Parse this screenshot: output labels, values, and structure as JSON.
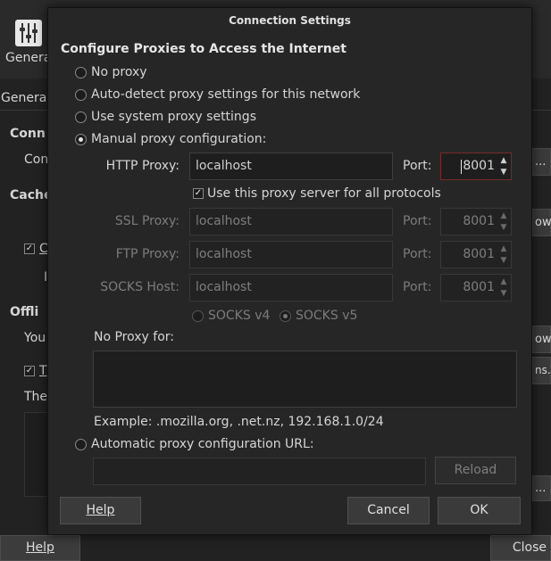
{
  "background_window": {
    "toolbar_tab_label": "Genera",
    "subtab_label": "General",
    "section_connection": "Conn",
    "connection_text": "Con",
    "section_cache": "Cache",
    "cache_check_label": "C",
    "cache_sub": "I",
    "section_offline": "Offli",
    "offline_text": "You",
    "offline_check_label": "T",
    "offline_text2": "The",
    "right_btn_settings": "...",
    "right_btn_now1": "ow",
    "right_btn_now2": "ow",
    "right_btn_ns": "ns...",
    "right_btn_dots": "...",
    "help_button": "Help",
    "close_button": "Close"
  },
  "dialog": {
    "title": "Connection Settings",
    "heading": "Configure Proxies to Access the Internet",
    "options": {
      "no_proxy": "No proxy",
      "auto_detect": "Auto-detect proxy settings for this network",
      "system": "Use system proxy settings",
      "manual": "Manual proxy configuration:",
      "auto_url": "Automatic proxy configuration URL:"
    },
    "http": {
      "label": "HTTP Proxy:",
      "value": "localhost",
      "port_label": "Port:",
      "port": "8001"
    },
    "use_for_all": "Use this proxy server for all protocols",
    "ssl": {
      "label": "SSL Proxy:",
      "value": "localhost",
      "port_label": "Port:",
      "port": "8001"
    },
    "ftp": {
      "label": "FTP Proxy:",
      "value": "localhost",
      "port_label": "Port:",
      "port": "8001"
    },
    "socks": {
      "label": "SOCKS Host:",
      "value": "localhost",
      "port_label": "Port:",
      "port": "8001"
    },
    "socks_v4": "SOCKS v4",
    "socks_v5": "SOCKS v5",
    "no_proxy_for_label": "No Proxy for:",
    "no_proxy_for_value": "",
    "example": "Example: .mozilla.org, .net.nz, 192.168.1.0/24",
    "auto_url_value": "",
    "reload_button": "Reload",
    "help_button": "Help",
    "cancel_button": "Cancel",
    "ok_button": "OK"
  }
}
